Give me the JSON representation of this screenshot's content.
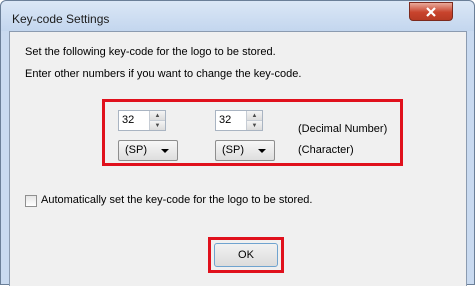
{
  "window": {
    "title": "Key-code Settings"
  },
  "instructions": {
    "line1": "Set the following key-code for the logo to be stored.",
    "line2": "Enter other numbers if you want to change the key-code."
  },
  "keycode": {
    "first": {
      "number": "32",
      "character": "(SP)"
    },
    "second": {
      "number": "32",
      "character": "(SP)"
    },
    "number_label": "(Decimal Number)",
    "character_label": "(Character)"
  },
  "auto_checkbox": {
    "label": "Automatically set the key-code for the logo to be stored.",
    "checked": false
  },
  "ok_button": {
    "label": "OK"
  },
  "colors": {
    "highlight": "#e0101c",
    "close_button": "#c8432c",
    "frame": "#c9daf0"
  },
  "icons": {
    "close": "close-icon",
    "spin_up": "spin-up-icon",
    "spin_down": "spin-down-icon",
    "combo": "chevron-down-icon"
  }
}
